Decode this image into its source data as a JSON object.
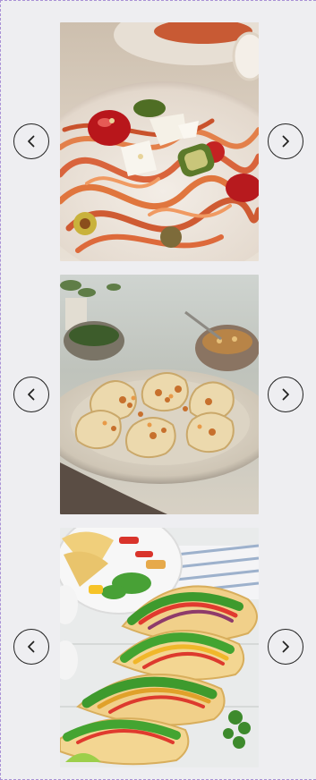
{
  "carousels": [
    {
      "image_subject": "spaghetti-with-tomato-zucchini-olives",
      "prev_icon": "chevron-left-icon",
      "next_icon": "chevron-right-icon"
    },
    {
      "image_subject": "ravioli-with-crispy-topping",
      "prev_icon": "chevron-left-icon",
      "next_icon": "chevron-right-icon"
    },
    {
      "image_subject": "chicken-vegetable-tacos",
      "prev_icon": "chevron-left-icon",
      "next_icon": "chevron-right-icon"
    }
  ],
  "colors": {
    "border_dash": "#a991d6",
    "background": "#eeeef1",
    "button_stroke": "#222222"
  }
}
